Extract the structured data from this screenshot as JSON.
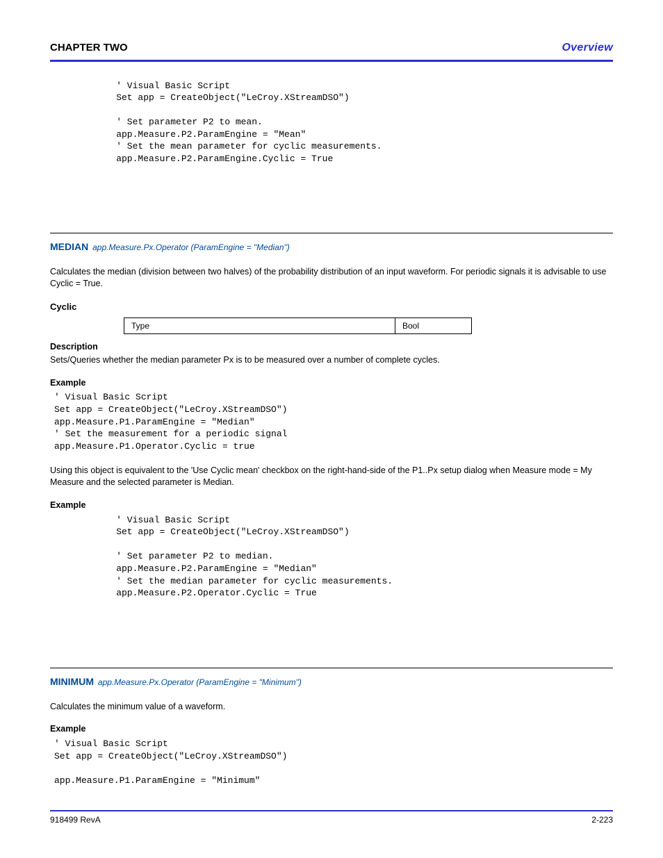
{
  "header": {
    "left": "CHAPTER TWO",
    "right": "Overview"
  },
  "footer": {
    "left": "918499 RevA",
    "right": "2-223"
  },
  "block1_example": "    ' Visual Basic Script\n    Set app = CreateObject(\"LeCroy.XStreamDSO\")\n\n    ' Set parameter P2 to mean.\n    app.Measure.P2.ParamEngine = \"Mean\"\n    ' Set the mean parameter for cyclic measurements.\n    app.Measure.P2.ParamEngine.Cyclic = True",
  "median_section": {
    "title": "MEDIAN",
    "path": "app.Measure.Px.Operator (ParamEngine = \"Median\")",
    "intro": "Calculates the median (division between two halves) of the probability distribution of an input waveform. For periodic signals it is advisable to use Cyclic = True.",
    "prop_name": "Cyclic",
    "attr_type_label": "Type",
    "attr_type": "Bool",
    "desc_label": "Description",
    "desc": "Sets/Queries whether the median parameter Px is to be measured over a number of complete cycles.",
    "example_label": "Example",
    "example": "' Visual Basic Script\nSet app = CreateObject(\"LeCroy.XStreamDSO\")\napp.Measure.P1.ParamEngine = \"Median\"\n' Set the measurement for a periodic signal\napp.Measure.P1.Operator.Cyclic = true",
    "post": "Using this object is equivalent to the 'Use Cyclic mean' checkbox on the right-hand-side of the P1..Px setup dialog when Measure mode = My Measure and the selected parameter is Median.",
    "example2_label": "Example",
    "example2": "    ' Visual Basic Script\n    Set app = CreateObject(\"LeCroy.XStreamDSO\")\n\n    ' Set parameter P2 to median.\n    app.Measure.P2.ParamEngine = \"Median\"\n    ' Set the median parameter for cyclic measurements.\n    app.Measure.P2.Operator.Cyclic = True"
  },
  "minimum_section": {
    "title": "MINIMUM",
    "path": "app.Measure.Px.Operator (ParamEngine = \"Minimum\")",
    "intro": "Calculates the minimum value of a waveform.",
    "example_label": "Example",
    "example": "' Visual Basic Script\nSet app = CreateObject(\"LeCroy.XStreamDSO\")\n\napp.Measure.P1.ParamEngine = \"Minimum\""
  }
}
